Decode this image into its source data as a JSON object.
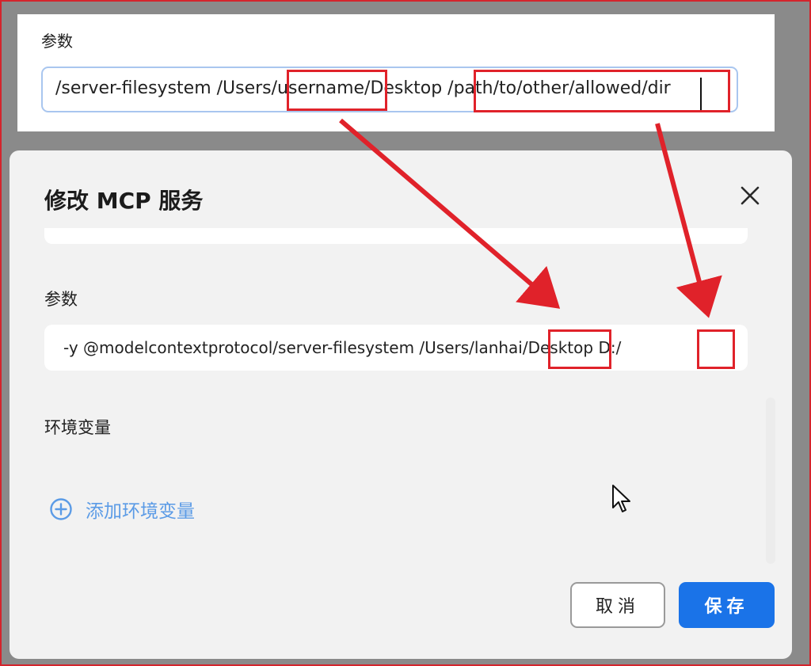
{
  "top_snippet": {
    "label": "参数",
    "input_value": "/server-filesystem /Users/username/Desktop /path/to/other/allowed/dir"
  },
  "modal": {
    "title": "修改 MCP 服务",
    "close_icon": "close-icon",
    "args_label": "参数",
    "args_value": "-y @modelcontextprotocol/server-filesystem /Users/lanhai/Desktop D:/",
    "env_label": "环境变量",
    "add_env_label": "添加环境变量",
    "add_env_icon": "plus-circle-icon",
    "cancel_label": "取消",
    "save_label": "保存"
  },
  "colors": {
    "annotation_red": "#e0222a",
    "primary_blue": "#1a73e8",
    "link_blue": "#5b9be6",
    "modal_bg": "#f2f2f2",
    "overlay": "#8a8a8a"
  }
}
